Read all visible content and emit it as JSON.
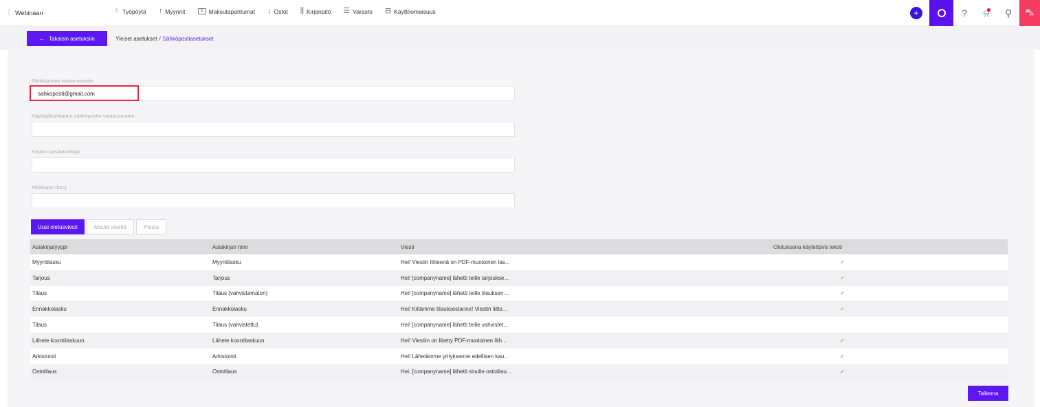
{
  "app": {
    "name": "Webinaari"
  },
  "nav": [
    {
      "label": "Työpöytä",
      "icon": "grid-icon"
    },
    {
      "label": "Myynnit",
      "icon": "arrow-up-icon"
    },
    {
      "label": "Maksutapahtumat",
      "icon": "payment-icon"
    },
    {
      "label": "Ostot",
      "icon": "arrow-down-icon"
    },
    {
      "label": "Kirjanpito",
      "icon": "bar-chart-icon"
    },
    {
      "label": "Varasto",
      "icon": "warehouse-icon"
    },
    {
      "label": "Käyttöomaisuus",
      "icon": "briefcase-icon"
    }
  ],
  "header_icons": [
    "plus-icon",
    "settings-icon",
    "help-icon",
    "bell-icon",
    "user-icon",
    "cart-icon"
  ],
  "subbar": {
    "back_label": "Takaisin asetuksiin",
    "crumb_parent": "Yleiset asetukset",
    "crumb_sep": "/",
    "crumb_current": "Sähköpostiasetukset"
  },
  "form": {
    "reply_address": {
      "label": "Sähköpostin vastausosoite",
      "value": "sahkoposti@gmail.com"
    },
    "user_reply_address": {
      "label": "Käyttäjäkohtainen sähköpostin vastausosoite",
      "value": ""
    },
    "cc_recipient": {
      "label": "Kopion vastaanottaja",
      "value": ""
    },
    "bcc": {
      "label": "Piilokopio (bcc)",
      "value": ""
    }
  },
  "actions": {
    "new_label": "Uusi oletusviesti",
    "edit_label": "Muuta viestiä",
    "delete_label": "Poista",
    "save_label": "Tallenna"
  },
  "table": {
    "headers": [
      "Asiakirjatyyppi",
      "Asiakirjan nimi",
      "Viesti",
      "Oletuksena käytettävä teksti"
    ],
    "rows": [
      {
        "type": "Myyntilasku",
        "name": "Myyntilasku",
        "message": "Hei! Viestin liitteenä on PDF-muotoinen las...",
        "default": "✓"
      },
      {
        "type": "Tarjous",
        "name": "Tarjous",
        "message": "Hei! [companyname] lähetti teille tarjoukse...",
        "default": "✓"
      },
      {
        "type": "Tilaus",
        "name": "Tilaus (vahvistamaton)",
        "message": "Hei! [companyname] lähetti teille tilauksen ...",
        "default": "✓"
      },
      {
        "type": "Ennakkolasku",
        "name": "Ennakkolasku",
        "message": "Hei! Kiitämme tilauksestanne! Viestin liitte...",
        "default": "✓"
      },
      {
        "type": "Tilaus",
        "name": "Tilaus (vahvistettu)",
        "message": "Hei! [companyname] lähetti teille vahvistet...",
        "default": ""
      },
      {
        "type": "Lähete koontilaskuun",
        "name": "Lähete koontilaskuun",
        "message": "Hei! Viestiin on liitetty PDF-muotoinen läh...",
        "default": "✓"
      },
      {
        "type": "Arkistointi",
        "name": "Arkistointi",
        "message": "Hei! Lähetämme yrityksenne edellisen kau...",
        "default": "✓"
      },
      {
        "type": "Ostotilaus",
        "name": "Ostotilaus",
        "message": "Hei, [companyname] lähetti sinulle ostotilau...",
        "default": "✓"
      }
    ]
  },
  "colors": {
    "accent": "#5c17f2",
    "cart": "#f43b64",
    "highlight": "#e02a3c"
  }
}
